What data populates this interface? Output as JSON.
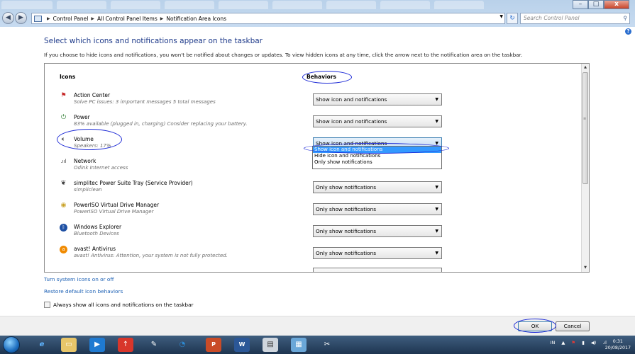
{
  "window": {
    "address_crumbs": [
      "Control Panel",
      "All Control Panel Items",
      "Notification Area Icons"
    ],
    "search_placeholder": "Search Control Panel",
    "minimize": "–",
    "maximize": "□",
    "close": "x"
  },
  "page": {
    "title": "Select which icons and notifications appear on the taskbar",
    "description": "If you choose to hide icons and notifications, you won't be notified about changes or updates. To view hidden icons at any time, click the arrow next to the notification area on the taskbar.",
    "col_icons": "Icons",
    "col_behaviors": "Behaviors"
  },
  "rows": [
    {
      "name": "Action Center",
      "sub": "Solve PC issues: 3 important messages  5 total messages",
      "behavior": "Show icon and notifications",
      "icon": "flag-icon"
    },
    {
      "name": "Power",
      "sub": "83% available (plugged in, charging)  Consider replacing your battery.",
      "behavior": "Show icon and notifications",
      "icon": "power-icon"
    },
    {
      "name": "Volume",
      "sub": "Speakers: 17%",
      "behavior": "Show icon and notifications",
      "icon": "speaker-icon"
    },
    {
      "name": "Network",
      "sub": "Odink Internet access",
      "behavior": "",
      "icon": "network-icon"
    },
    {
      "name": "simplitec Power Suite Tray (Service Provider)",
      "sub": "simpliclean",
      "behavior": "Only show notifications",
      "icon": "simplitec-icon"
    },
    {
      "name": "PowerISO Virtual Drive Manager",
      "sub": "PowerISO Virtual Drive Manager",
      "behavior": "Only show notifications",
      "icon": "poweriso-icon"
    },
    {
      "name": "Windows Explorer",
      "sub": "Bluetooth Devices",
      "behavior": "Only show notifications",
      "icon": "bluetooth-icon"
    },
    {
      "name": "avast! Antivirus",
      "sub": "avast! Antivirus: Attention, your system is not fully protected.",
      "behavior": "Only show notifications",
      "icon": "avast-icon"
    }
  ],
  "dropdown_options": [
    "Show icon and notifications",
    "Hide icon and notifications",
    "Only show notifications"
  ],
  "links": {
    "system_icons": "Turn system icons on or off",
    "restore": "Restore default icon behaviors"
  },
  "always_show_label": "Always show all icons and notifications on the taskbar",
  "buttons": {
    "ok": "OK",
    "cancel": "Cancel"
  },
  "taskbar": {
    "lang": "IN",
    "time": "0:31",
    "date": "20/08/2017"
  },
  "colors": {
    "annotation": "#1e2bd6",
    "link": "#1a5fb4",
    "selection": "#3399ff"
  }
}
